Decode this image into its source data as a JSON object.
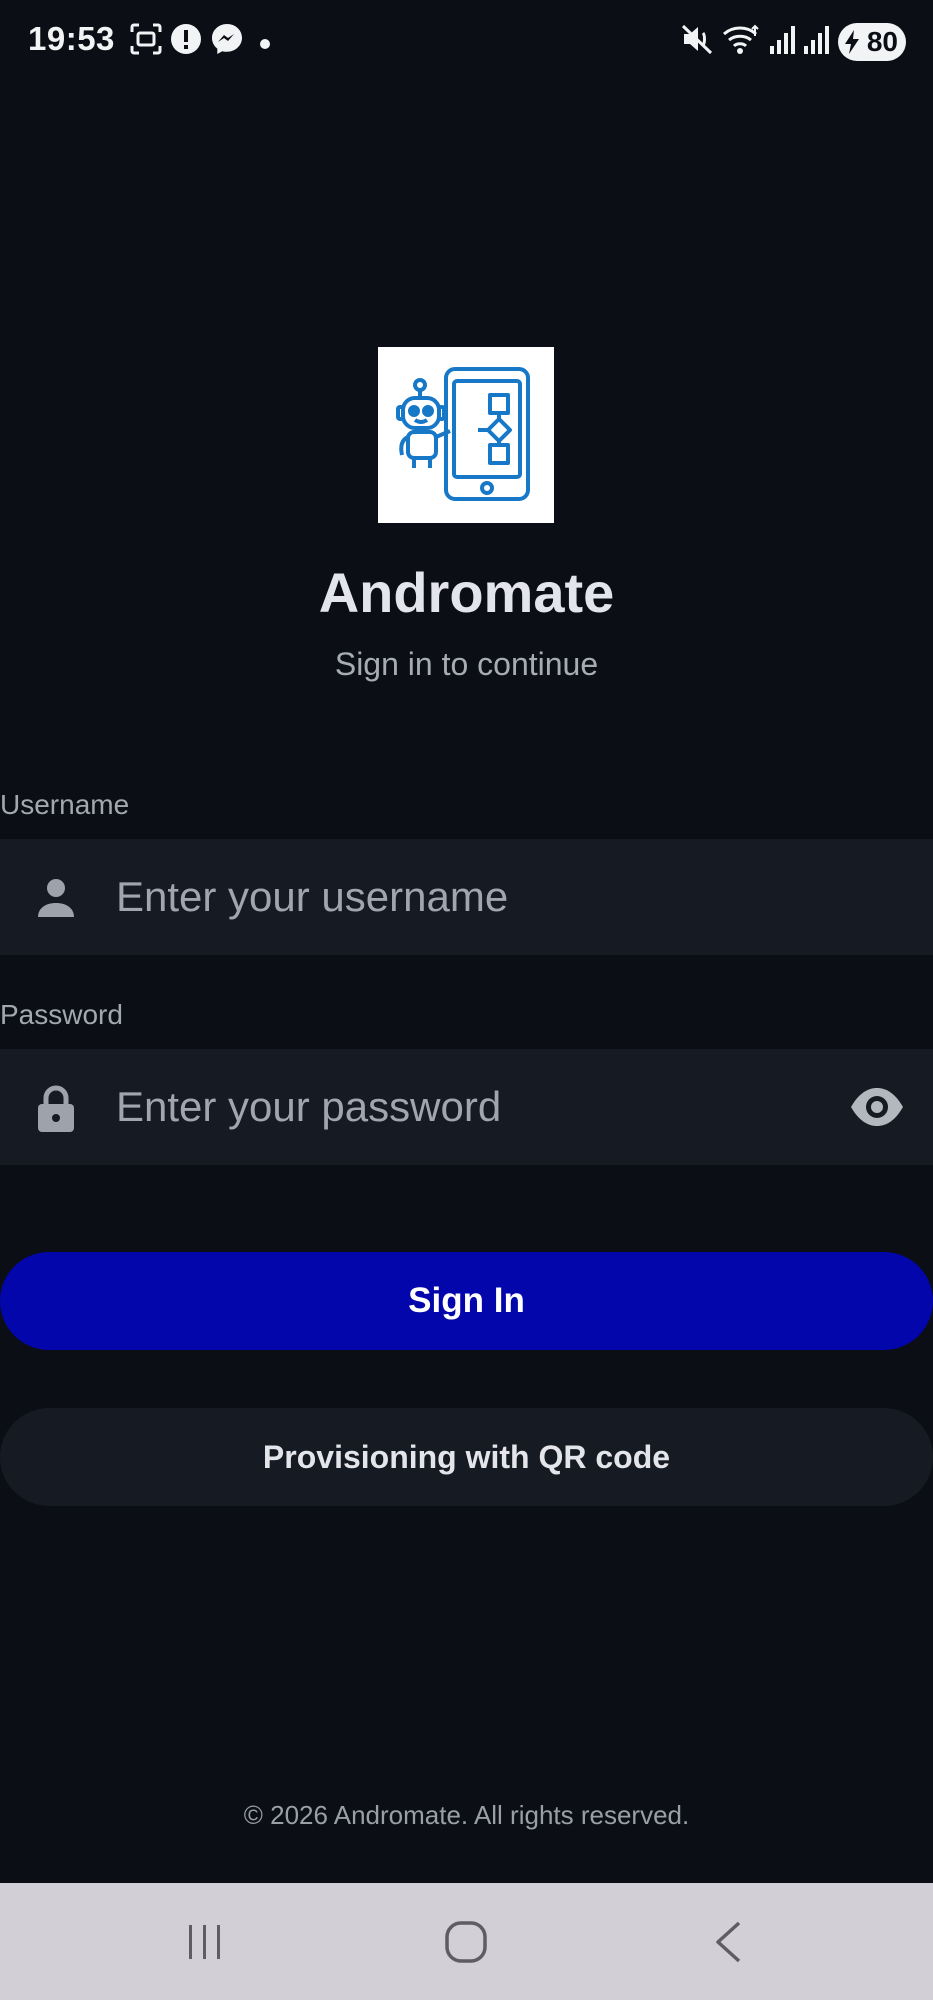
{
  "status_bar": {
    "time": "19:53",
    "battery_level": "80",
    "icons_left": [
      "screenshot-icon",
      "alert-icon",
      "messenger-icon",
      "dot-icon"
    ],
    "icons_right": [
      "mute-icon",
      "wifi-icon",
      "signal-icon",
      "signal-icon"
    ]
  },
  "app": {
    "name": "Andromate",
    "subtitle": "Sign in to continue",
    "logo_icon": "robot-phone-logo-icon"
  },
  "form": {
    "username_label": "Username",
    "username_placeholder": "Enter your username",
    "username_value": "",
    "password_label": "Password",
    "password_placeholder": "Enter your password",
    "password_value": ""
  },
  "buttons": {
    "sign_in": "Sign In",
    "qr": "Provisioning with QR code"
  },
  "footer": {
    "copyright": "© 2026 Andromate. All rights reserved."
  },
  "colors": {
    "background": "#0b0e15",
    "field": "#161a22",
    "primary": "#0306ab",
    "logo_accent": "#1878c8",
    "nav_bar": "#d3cfd6"
  },
  "nav": {
    "items": [
      "recent-apps-icon",
      "home-icon",
      "back-icon"
    ]
  }
}
